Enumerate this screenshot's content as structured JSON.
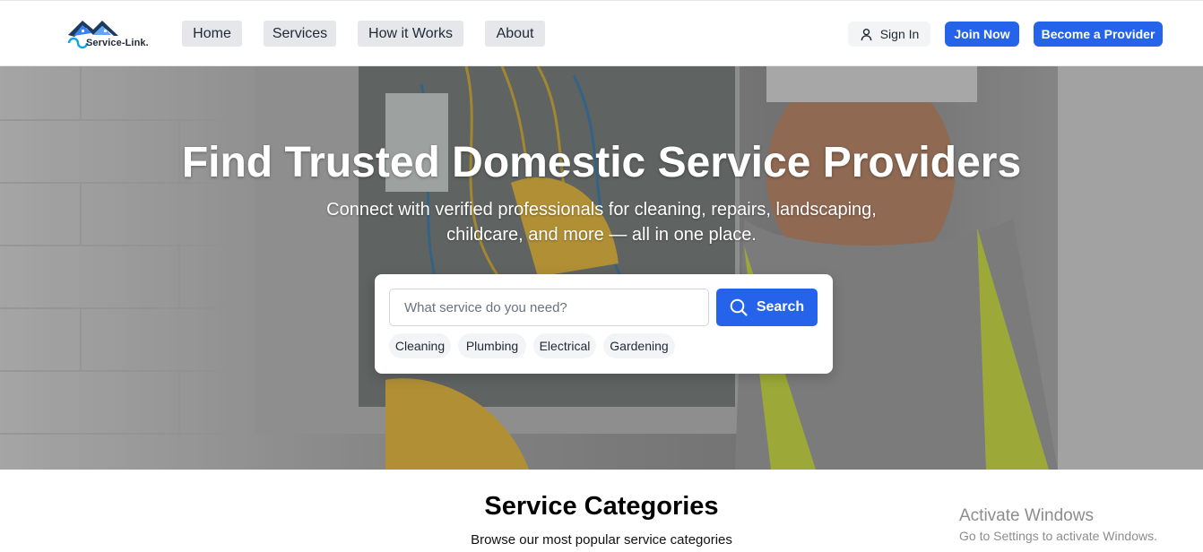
{
  "brand": {
    "name": "Service-Link."
  },
  "nav": {
    "items": [
      {
        "label": "Home"
      },
      {
        "label": "Services"
      },
      {
        "label": "How it Works"
      },
      {
        "label": "About"
      }
    ]
  },
  "auth": {
    "sign_in": "Sign In",
    "join_now": "Join Now",
    "become_provider": "Become a Provider"
  },
  "hero": {
    "title": "Find Trusted Domestic Service Providers",
    "subtitle": "Connect with verified professionals for cleaning, repairs, landscaping, childcare, and more — all in one place.",
    "search": {
      "placeholder": "What service do you need?",
      "value": "",
      "button_label": "Search"
    },
    "chips": [
      {
        "label": "Cleaning"
      },
      {
        "label": "Plumbing"
      },
      {
        "label": "Electrical"
      },
      {
        "label": "Gardening"
      }
    ]
  },
  "categories": {
    "title": "Service Categories",
    "subtitle": "Browse our most popular service categories"
  },
  "watermark": {
    "line1": "Activate Windows",
    "line2": "Go to Settings to activate Windows."
  },
  "colors": {
    "primary": "#2563eb",
    "nav_bg": "#e5e7eb",
    "chip_bg": "#f3f4f6"
  },
  "icons": {
    "brand": "house-roof-logo-icon",
    "sign_in": "user-icon",
    "search": "search-icon"
  }
}
